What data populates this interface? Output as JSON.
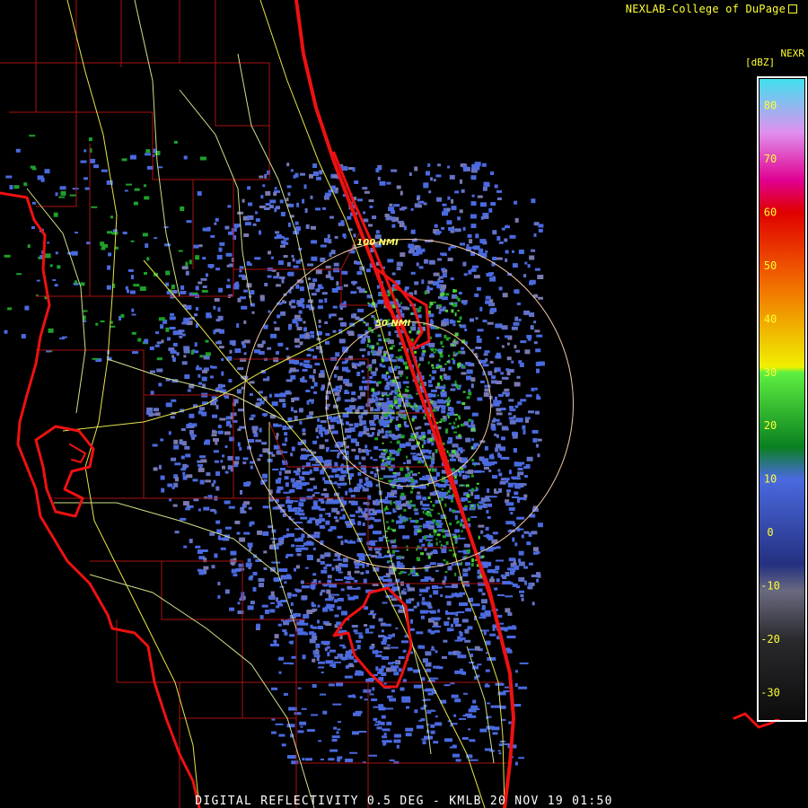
{
  "credit": "NEXLAB-College of DuPage",
  "product_code": "NEXR",
  "unit_label": "[dBZ]",
  "footer_caption": "DIGITAL REFLECTIVITY 0.5 DEG - KMLB 20 NOV 19 01:50",
  "range_rings": [
    {
      "label": "100 NMI",
      "nmi": 100
    },
    {
      "label": "50 NMI",
      "nmi": 50
    }
  ],
  "colorbar": {
    "min_dbz": -35,
    "max_dbz": 85,
    "ticks": [
      80,
      70,
      60,
      50,
      40,
      30,
      20,
      10,
      0,
      -10,
      -20,
      -30
    ],
    "stops": [
      {
        "dbz": -35,
        "color": "#0c0c0c"
      },
      {
        "dbz": -20,
        "color": "#2a2a2e"
      },
      {
        "dbz": -11,
        "color": "#6a6a80"
      },
      {
        "dbz": -6,
        "color": "#243080"
      },
      {
        "dbz": 10,
        "color": "#4a6ae0"
      },
      {
        "dbz": 16,
        "color": "#0a8020"
      },
      {
        "dbz": 30,
        "color": "#5ef040"
      },
      {
        "dbz": 31,
        "color": "#f0f000"
      },
      {
        "dbz": 48,
        "color": "#f06000"
      },
      {
        "dbz": 60,
        "color": "#e00000"
      },
      {
        "dbz": 66,
        "color": "#e00090"
      },
      {
        "dbz": 75,
        "color": "#e090f0"
      },
      {
        "dbz": 85,
        "color": "#40e0f0"
      }
    ]
  },
  "colors": {
    "coastline": "#ee1111",
    "county_lines": "#aa1212",
    "highways": "#e6e64a",
    "roads": "#cfe08a",
    "range_ring": "#f0c8a0",
    "echo_weak": "#4a6ae0",
    "echo_faint": "#6272c8",
    "echo_grey": "#7a7ab0",
    "echo_green": "#1ea02a",
    "echo_bright_green": "#50d03a"
  }
}
